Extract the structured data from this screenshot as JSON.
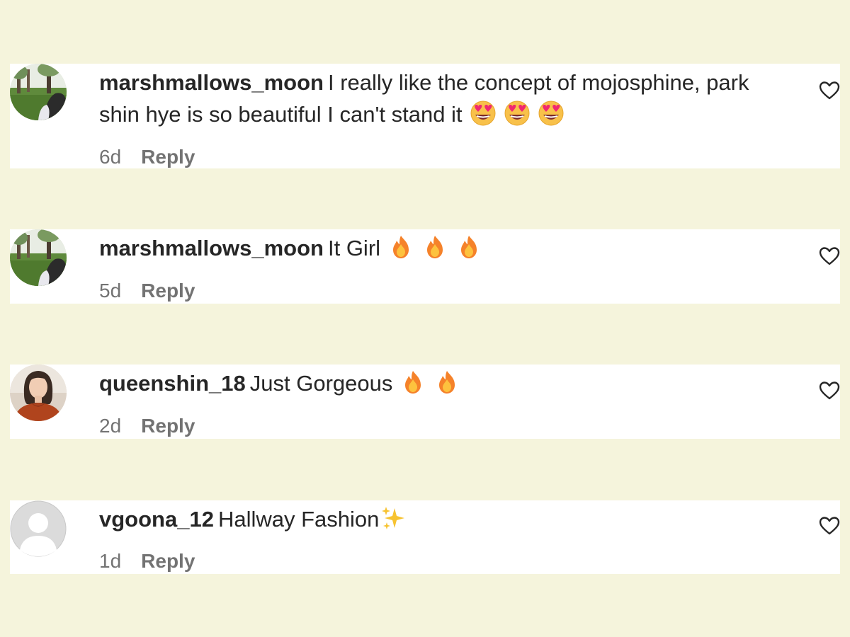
{
  "comments": [
    {
      "username": "marshmallows_moon",
      "text": "I really like the concept of mojosphine, park shin hye is so beautiful I can't stand it",
      "emojis": [
        "heart-eyes-emoji",
        "heart-eyes-emoji",
        "heart-eyes-emoji"
      ],
      "time": "6d",
      "reply_label": "Reply",
      "avatar": "park-photo-avatar",
      "like_icon": "heart-outline-icon"
    },
    {
      "username": "marshmallows_moon",
      "text": "It Girl",
      "emojis": [
        "fire-emoji",
        "fire-emoji",
        "fire-emoji"
      ],
      "time": "5d",
      "reply_label": "Reply",
      "avatar": "park-photo-avatar",
      "like_icon": "heart-outline-icon"
    },
    {
      "username": "queenshin_18",
      "text": "Just Gorgeous",
      "emojis": [
        "fire-emoji",
        "fire-emoji"
      ],
      "time": "2d",
      "reply_label": "Reply",
      "avatar": "woman-portrait-avatar",
      "like_icon": "heart-outline-icon"
    },
    {
      "username": "vgoona_12",
      "text": "Hallway Fashion",
      "emojis": [
        "sparkles-emoji"
      ],
      "time": "1d",
      "reply_label": "Reply",
      "avatar": "default-user-avatar",
      "like_icon": "heart-outline-icon"
    }
  ],
  "colors": {
    "background": "#f5f4dc",
    "card": "#ffffff",
    "text": "#262626",
    "meta": "#737373"
  }
}
